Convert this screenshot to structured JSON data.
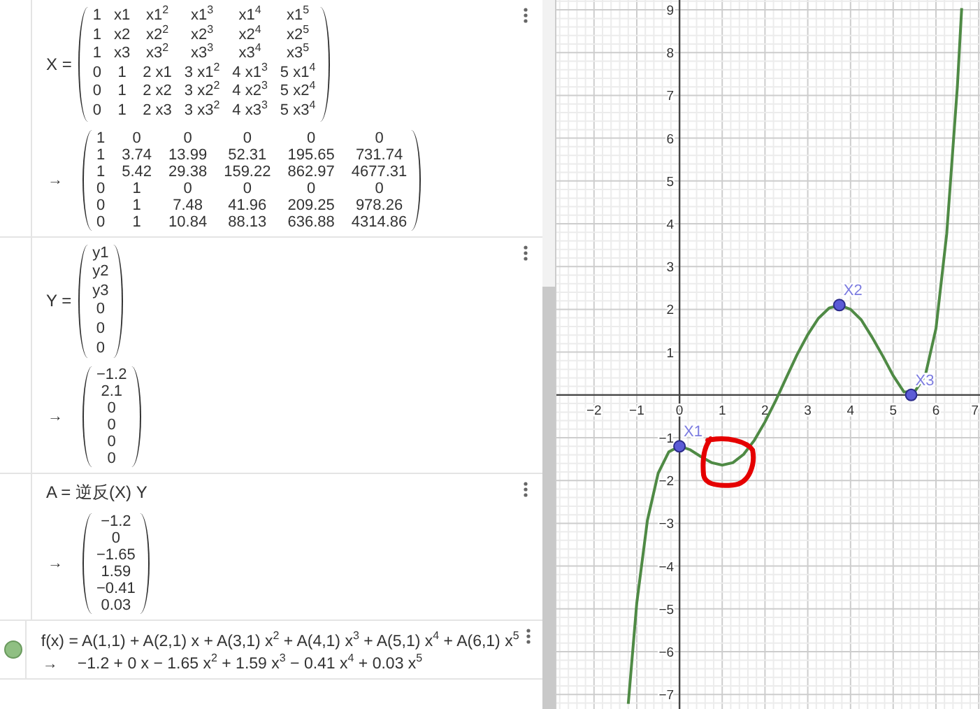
{
  "algebra_view": {
    "entries": [
      {
        "kind": "matrix",
        "label": "X =",
        "matrix": [
          [
            "1",
            "x1",
            "x1$^{2}$",
            "x1$^{3}$",
            "x1$^{4}$",
            "x1$^{5}$"
          ],
          [
            "1",
            "x2",
            "x2$^{2}$",
            "x2$^{3}$",
            "x2$^{4}$",
            "x2$^{5}$"
          ],
          [
            "1",
            "x3",
            "x3$^{2}$",
            "x3$^{3}$",
            "x3$^{4}$",
            "x3$^{5}$"
          ],
          [
            "0",
            "1",
            "2 x1",
            "3 x1$^{2}$",
            "4 x1$^{3}$",
            "5 x1$^{4}$"
          ],
          [
            "0",
            "1",
            "2 x2",
            "3 x2$^{2}$",
            "4 x2$^{3}$",
            "5 x2$^{4}$"
          ],
          [
            "0",
            "1",
            "2 x3",
            "3 x3$^{2}$",
            "4 x3$^{3}$",
            "5 x3$^{4}$"
          ]
        ],
        "arrow": "→",
        "result": [
          [
            "1",
            "0",
            "0",
            "0",
            "0",
            "0"
          ],
          [
            "1",
            "3.74",
            "13.99",
            "52.31",
            "195.65",
            "731.74"
          ],
          [
            "1",
            "5.42",
            "29.38",
            "159.22",
            "862.97",
            "4677.31"
          ],
          [
            "0",
            "1",
            "0",
            "0",
            "0",
            "0"
          ],
          [
            "0",
            "1",
            "7.48",
            "41.96",
            "209.25",
            "978.26"
          ],
          [
            "0",
            "1",
            "10.84",
            "88.13",
            "636.88",
            "4314.86"
          ]
        ]
      },
      {
        "kind": "matrix",
        "label": "Y =",
        "matrix": [
          [
            "y1"
          ],
          [
            "y2"
          ],
          [
            "y3"
          ],
          [
            "0"
          ],
          [
            "0"
          ],
          [
            "0"
          ]
        ],
        "arrow": "→",
        "result": [
          [
            "−1.2"
          ],
          [
            "2.1"
          ],
          [
            "0"
          ],
          [
            "0"
          ],
          [
            "0"
          ],
          [
            "0"
          ]
        ]
      },
      {
        "kind": "formula",
        "definition": "A = 逆反(X) Y",
        "arrow": "→",
        "result": [
          [
            "−1.2"
          ],
          [
            "0"
          ],
          [
            "−1.65"
          ],
          [
            "1.59"
          ],
          [
            "−0.41"
          ],
          [
            "0.03"
          ]
        ]
      },
      {
        "kind": "function",
        "visible": true,
        "definition": "f(x) = A(1,1) + A(2,1) x + A(3,1) x$^{2}$ + A(4,1) x$^{3}$ + A(5,1) x$^{4}$ + A(6,1) x$^{5}$",
        "arrow": "→",
        "value": "−1.2 + 0 x − 1.65 x$^{2}$ + 1.59 x$^{3}$ − 0.41 x$^{4}$ + 0.03 x$^{5}$"
      }
    ]
  },
  "graphics_view": {
    "scribble_around_minimum": true,
    "chart_data": {
      "type": "line",
      "grid": true,
      "xlim": [
        -2.88,
        7.03
      ],
      "ylim": [
        -7.34,
        9.23
      ],
      "xticks": [
        -2,
        -1,
        0,
        1,
        2,
        3,
        4,
        5,
        6,
        7
      ],
      "yticks": [
        -7,
        -6,
        -5,
        -4,
        -3,
        -2,
        -1,
        1,
        2,
        3,
        4,
        5,
        6,
        7,
        8,
        9
      ],
      "x": [
        -1.2,
        -1,
        -0.75,
        -0.5,
        -0.25,
        0,
        0.25,
        0.5,
        0.75,
        1,
        1.25,
        1.5,
        1.75,
        2,
        2.25,
        2.5,
        2.75,
        3,
        3.25,
        3.5,
        3.75,
        4,
        4.25,
        4.5,
        4.75,
        5,
        5.25,
        5.5,
        5.75,
        6,
        6.25,
        6.5,
        6.6
      ],
      "series": [
        {
          "color": "#4f8a45",
          "values": [
            -7.22,
            -4.86,
            -2.93,
            -1.83,
            -1.33,
            -1.2,
            -1.28,
            -1.44,
            -1.58,
            -1.64,
            -1.58,
            -1.39,
            -1.06,
            -0.63,
            -0.13,
            0.41,
            0.94,
            1.41,
            1.79,
            2.03,
            2.1,
            2.0,
            1.76,
            1.36,
            0.92,
            0.45,
            0.07,
            0.07,
            0.46,
            1.55,
            3.77,
            7.2,
            9.04
          ]
        }
      ],
      "annotations": [
        {
          "x": 0,
          "y": -1.2,
          "text": "X1"
        },
        {
          "x": 3.74,
          "y": 2.1,
          "text": "X2"
        },
        {
          "x": 5.42,
          "y": 0,
          "text": "X3"
        }
      ]
    }
  }
}
